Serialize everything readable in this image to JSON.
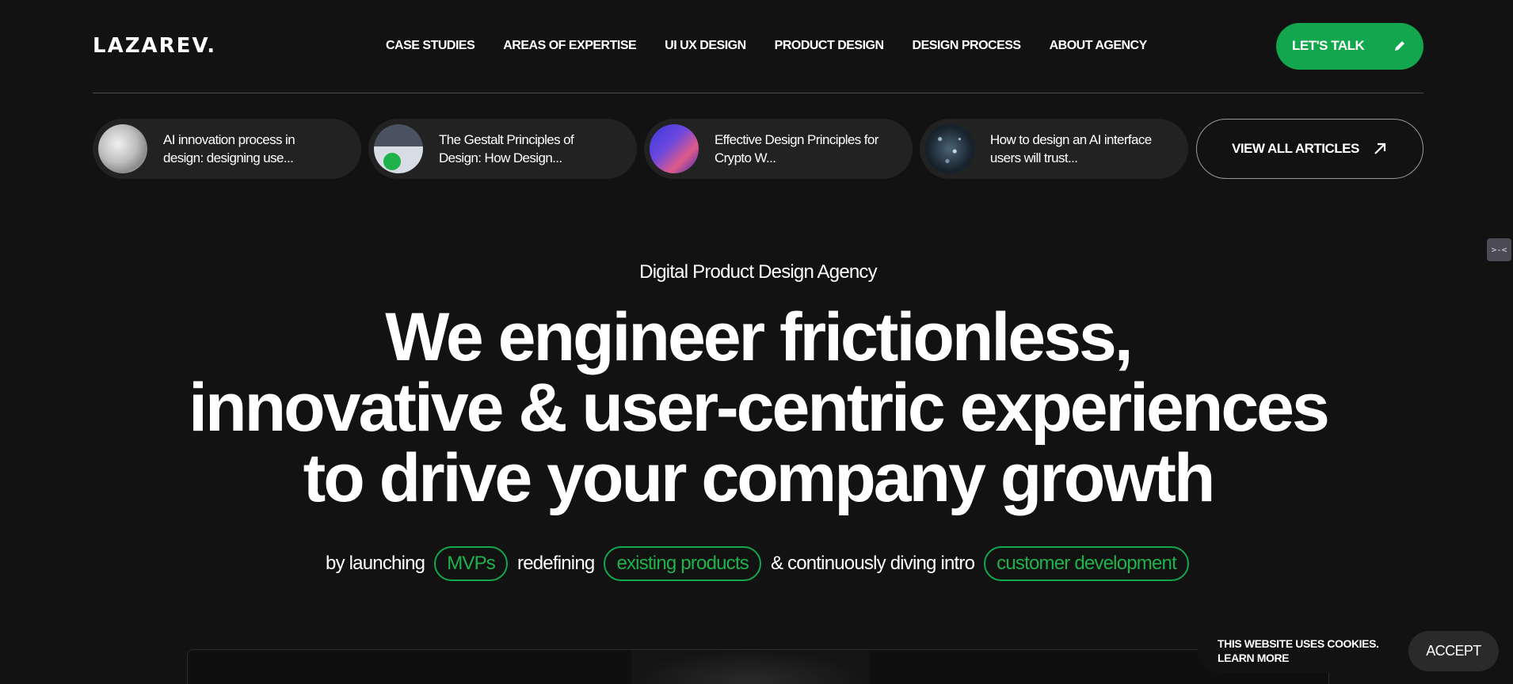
{
  "brand": {
    "logo": "LAZAREV."
  },
  "nav": {
    "items": [
      {
        "label": "CASE STUDIES"
      },
      {
        "label": "AREAS OF EXPERTISE"
      },
      {
        "label": "UI UX DESIGN"
      },
      {
        "label": "PRODUCT DESIGN"
      },
      {
        "label": "DESIGN PROCESS"
      },
      {
        "label": "ABOUT AGENCY"
      }
    ],
    "cta_label": "LET'S TALK",
    "cta_icon": "pencil-icon",
    "accent_color": "#12a64e"
  },
  "articles": {
    "items": [
      {
        "title": "AI innovation process in design: designing use...",
        "thumb": "silver-abstract"
      },
      {
        "title": "The Gestalt Principles of Design: How Design...",
        "thumb": "gestalt-shapes"
      },
      {
        "title": "Effective Design Principles for Crypto W...",
        "thumb": "crypto-ui"
      },
      {
        "title": "How to design an AI interface users will trust...",
        "thumb": "particle-sphere"
      }
    ],
    "view_all_label": "VIEW ALL ARTICLES",
    "view_all_icon": "arrow-up-right-icon"
  },
  "hero": {
    "eyebrow": "Digital Product Design Agency",
    "headline_lines": [
      "We engineer frictionless,",
      "innovative & user-centric experiences",
      "to drive your company growth"
    ],
    "tagline": {
      "part1": "by launching",
      "pill1": "MVPs",
      "part2": "redefining",
      "pill2": "existing products",
      "part3": "& continuously diving intro",
      "pill3": "customer development"
    }
  },
  "side_widget": {
    "icon": "collapse-icon",
    "glyph": ">-<"
  },
  "cookie": {
    "message": "THIS WEBSITE USES COOKIES.",
    "learn_more": "LEARN MORE",
    "accept_label": "ACCEPT"
  }
}
